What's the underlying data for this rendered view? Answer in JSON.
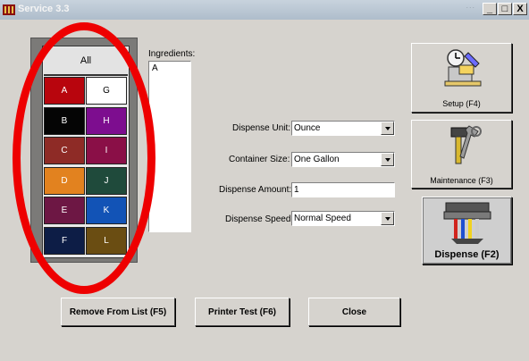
{
  "window": {
    "title": "Service 3.3",
    "background_title_fragment": "...",
    "buttons": [
      "_",
      "□",
      "X"
    ]
  },
  "palette": {
    "all_label": "All",
    "cells": [
      {
        "label": "A",
        "color": "#b8050d",
        "text_color": "#ffffff"
      },
      {
        "label": "G",
        "color": "#ffffff",
        "text_color": "#000000"
      },
      {
        "label": "B",
        "color": "#050505",
        "text_color": "#ffffff"
      },
      {
        "label": "H",
        "color": "#7d0d8f",
        "text_color": "#ffffff"
      },
      {
        "label": "C",
        "color": "#8e2b26",
        "text_color": "#ffffff"
      },
      {
        "label": "I",
        "color": "#8a0f47",
        "text_color": "#ffffff"
      },
      {
        "label": "D",
        "color": "#e2821f",
        "text_color": "#ffffff"
      },
      {
        "label": "J",
        "color": "#1f4a3b",
        "text_color": "#ffffff"
      },
      {
        "label": "E",
        "color": "#6d1744",
        "text_color": "#ffffff"
      },
      {
        "label": "K",
        "color": "#1253b6",
        "text_color": "#ffffff"
      },
      {
        "label": "F",
        "color": "#0d1d46",
        "text_color": "#ffffff"
      },
      {
        "label": "L",
        "color": "#6a4d12",
        "text_color": "#ffffff"
      }
    ]
  },
  "ingredients": {
    "label": "Ingredients:",
    "items": [
      "A"
    ]
  },
  "form": {
    "dispense_unit_label": "Dispense Unit:",
    "dispense_unit_value": "Ounce",
    "container_size_label": "Container Size:",
    "container_size_value": "One Gallon",
    "dispense_amount_label": "Dispense Amount:",
    "dispense_amount_value": "1",
    "dispense_speed_label": "Dispense Speed",
    "dispense_speed_value": "Normal Speed"
  },
  "side_buttons": {
    "setup": "Setup (F4)",
    "maintenance": "Maintenance (F3)",
    "dispense": "Dispense (F2)"
  },
  "bottom_buttons": {
    "remove": "Remove From List (F5)",
    "printer_test": "Printer Test (F6)",
    "close": "Close"
  },
  "colors": {
    "annotation_circle": "#ee0000",
    "window_face": "#d6d3ce"
  }
}
